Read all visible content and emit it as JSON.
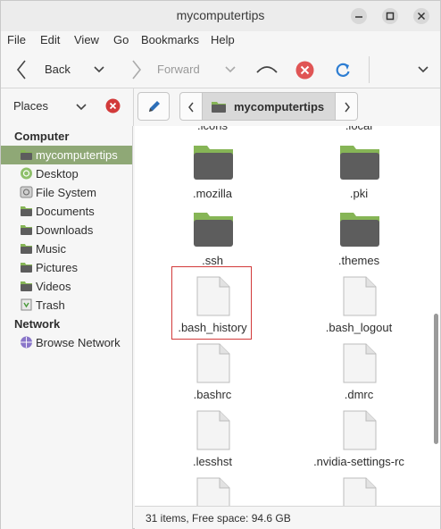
{
  "window": {
    "title": "mycomputertips"
  },
  "menubar": {
    "items": [
      "File",
      "Edit",
      "View",
      "Go",
      "Bookmarks",
      "Help"
    ]
  },
  "toolbar": {
    "back_label": "Back",
    "forward_label": "Forward"
  },
  "location": {
    "sidebar_mode": "Places",
    "current_folder": "mycomputertips"
  },
  "sidebar": {
    "computer_heading": "Computer",
    "network_heading": "Network",
    "computer_items": [
      {
        "label": "mycomputertips",
        "icon": "folder-home-icon",
        "selected": true
      },
      {
        "label": "Desktop",
        "icon": "desktop-icon"
      },
      {
        "label": "File System",
        "icon": "drive-icon"
      },
      {
        "label": "Documents",
        "icon": "folder-icon"
      },
      {
        "label": "Downloads",
        "icon": "folder-icon"
      },
      {
        "label": "Music",
        "icon": "folder-icon"
      },
      {
        "label": "Pictures",
        "icon": "folder-icon"
      },
      {
        "label": "Videos",
        "icon": "folder-icon"
      },
      {
        "label": "Trash",
        "icon": "trash-icon"
      }
    ],
    "network_items": [
      {
        "label": "Browse Network",
        "icon": "network-icon"
      }
    ]
  },
  "files": {
    "partial_top": [
      ".icons",
      ".local"
    ],
    "items": [
      {
        "name": ".mozilla",
        "type": "folder"
      },
      {
        "name": ".pki",
        "type": "folder"
      },
      {
        "name": ".ssh",
        "type": "folder"
      },
      {
        "name": ".themes",
        "type": "folder"
      },
      {
        "name": ".bash_history",
        "type": "file",
        "highlighted": true
      },
      {
        "name": ".bash_logout",
        "type": "file"
      },
      {
        "name": ".bashrc",
        "type": "file"
      },
      {
        "name": ".dmrc",
        "type": "file"
      },
      {
        "name": ".lesshst",
        "type": "file"
      },
      {
        "name": ".nvidia-settings-rc",
        "type": "file"
      }
    ]
  },
  "status": {
    "text": "31 items, Free space: 94.6 GB"
  },
  "colors": {
    "accent": "#8fa876",
    "folder_green": "#86b556",
    "folder_body": "#5d5d5d",
    "highlight_border": "#d23a3a"
  }
}
